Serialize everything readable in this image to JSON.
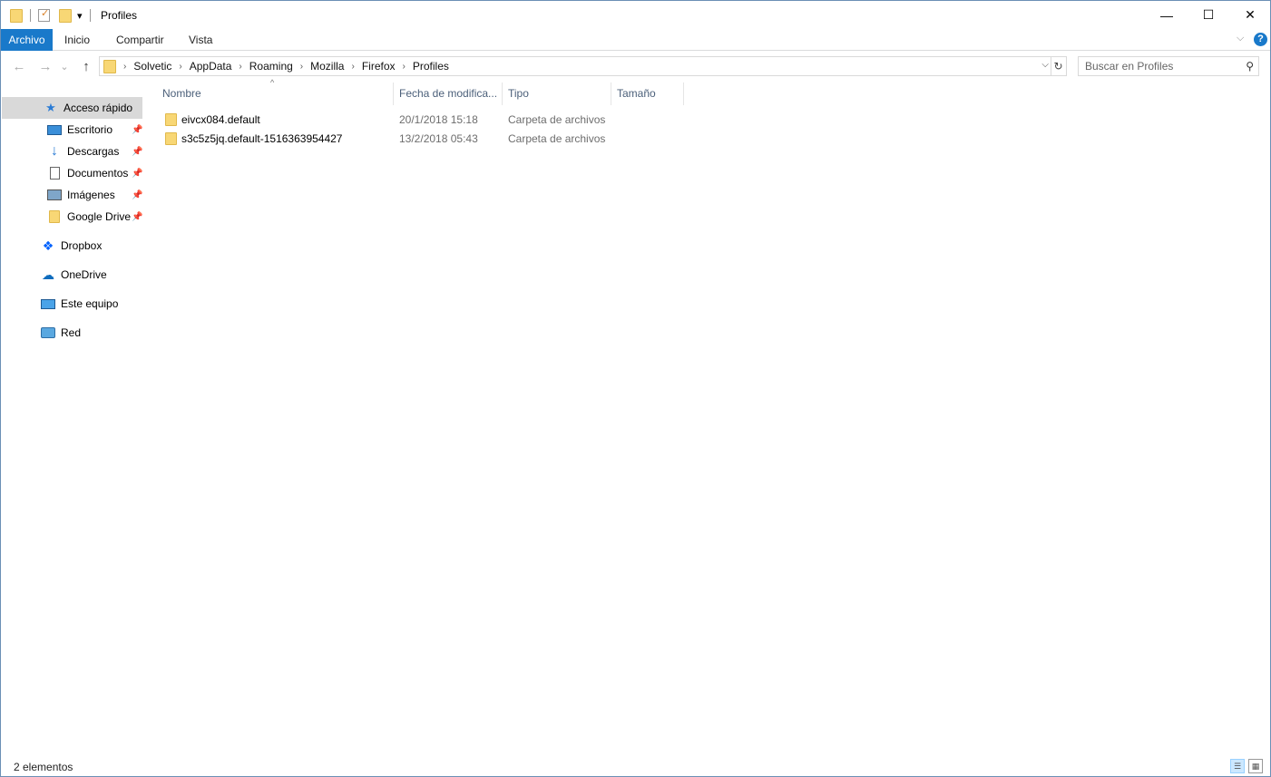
{
  "window": {
    "title": "Profiles",
    "controls": {
      "minimize": "—",
      "maximize": "☐",
      "close": "✕"
    }
  },
  "quick_access_toolbar": {
    "icons": [
      "folder-icon",
      "properties-check-icon",
      "new-folder-icon",
      "customize-dropdown-icon"
    ],
    "dropdown_glyph": "▾"
  },
  "ribbon": {
    "tabs": [
      "Archivo",
      "Inicio",
      "Compartir",
      "Vista"
    ],
    "expand_glyph": "⌵",
    "help_glyph": "?"
  },
  "navigation": {
    "back_glyph": "←",
    "forward_glyph": "→",
    "recent_glyph": "⌄",
    "up_glyph": "↑"
  },
  "address_bar": {
    "breadcrumbs": [
      "Solvetic",
      "AppData",
      "Roaming",
      "Mozilla",
      "Firefox",
      "Profiles"
    ],
    "separator": "›",
    "dropdown_glyph": "⌵",
    "refresh_glyph": "↻"
  },
  "search": {
    "placeholder": "Buscar en Profiles",
    "icon_glyph": "⚲"
  },
  "nav_pane": {
    "quick_access": {
      "label": "Acceso rápido",
      "icon": "star-icon",
      "glyph": "★"
    },
    "pinned": [
      {
        "label": "Escritorio",
        "icon": "desktop-icon"
      },
      {
        "label": "Descargas",
        "icon": "download-arrow-icon"
      },
      {
        "label": "Documentos",
        "icon": "document-icon"
      },
      {
        "label": "Imágenes",
        "icon": "pictures-icon"
      },
      {
        "label": "Google Drive",
        "icon": "folder-icon"
      }
    ],
    "pin_glyph": "📌",
    "locations": [
      {
        "label": "Dropbox",
        "icon": "dropbox-icon"
      },
      {
        "label": "OneDrive",
        "icon": "cloud-icon"
      },
      {
        "label": "Este equipo",
        "icon": "computer-icon"
      },
      {
        "label": "Red",
        "icon": "network-icon"
      }
    ]
  },
  "columns": {
    "name": "Nombre",
    "date": "Fecha de modifica...",
    "type": "Tipo",
    "size": "Tamaño",
    "sort_glyph": "^"
  },
  "files": [
    {
      "name": "eivcx084.default",
      "date": "20/1/2018 15:18",
      "type": "Carpeta de archivos",
      "size": ""
    },
    {
      "name": "s3c5z5jq.default-1516363954427",
      "date": "13/2/2018 05:43",
      "type": "Carpeta de archivos",
      "size": ""
    }
  ],
  "status_bar": {
    "item_count": "2 elementos",
    "details_view_glyph": "☰",
    "large_icons_glyph": "▦"
  },
  "colors": {
    "accent": "#1979ca",
    "selection": "#cce8ff",
    "folder": "#f8d775",
    "header_text": "#4c607a"
  }
}
